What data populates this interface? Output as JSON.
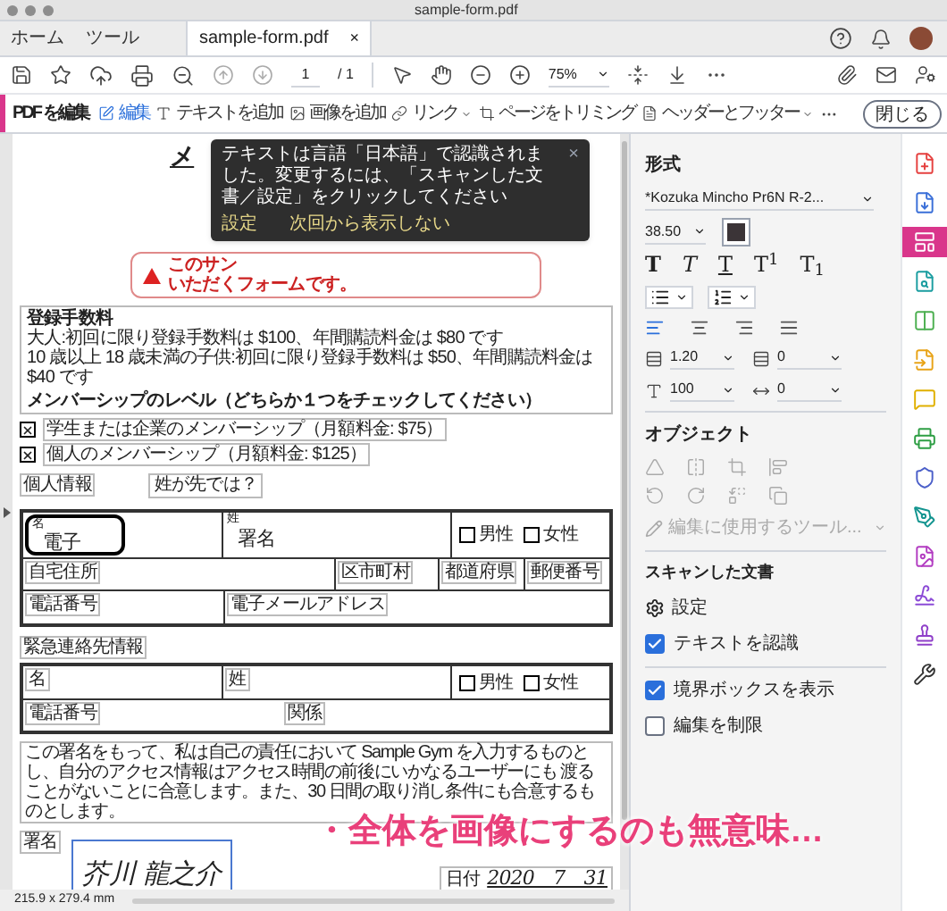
{
  "window": {
    "title": "sample-form.pdf"
  },
  "tabs": [
    {
      "label": "ホーム",
      "selected": false
    },
    {
      "label": "ツール",
      "selected": false
    },
    {
      "label": "sample-form.pdf",
      "selected": true,
      "close": "×"
    }
  ],
  "toolbar": {
    "page": "1",
    "page_total": "/ 1",
    "zoom": "75%"
  },
  "edit_bar": {
    "title": "PDF を編集",
    "tools": [
      {
        "label": "編集",
        "selected": true,
        "dropdown": false
      },
      {
        "label": "テキストを追加",
        "selected": false,
        "dropdown": false
      },
      {
        "label": "画像を追加",
        "selected": false,
        "dropdown": false
      },
      {
        "label": "リンク",
        "selected": false,
        "dropdown": true
      },
      {
        "label": "ページをトリミング",
        "selected": false,
        "dropdown": false
      },
      {
        "label": "ヘッダーとフッター",
        "selected": false,
        "dropdown": true
      }
    ],
    "close": "閉じる"
  },
  "document": {
    "heading": "メ",
    "warning": [
      "このサン",
      "いただくフォームです。"
    ],
    "toast": {
      "message": "テキストは言語「日本語」で認識されました。変更するには、「スキャンした文書／設定」をクリックしてください",
      "actions": [
        "設定",
        "次回から表示しない"
      ],
      "close": "×"
    },
    "fees": {
      "title": "登録手数料",
      "lines": [
        "大人:初回に限り登録手数料は $100、年間購読料金は $80 です",
        "10 歳以上 18 歳未満の子供:初回に限り登録手数料は $50、年間購読料金は $40 です"
      ],
      "level_title": "メンバーシップのレベル（どちらか１つをチェックしてください）"
    },
    "memberships": [
      {
        "label": "学生または企業のメンバーシップ（月額料金: $75）",
        "checked": true
      },
      {
        "label": "個人のメンバーシップ（月額料金: $125）",
        "checked": true
      }
    ],
    "comment": "姓が先では？",
    "personal": {
      "title": "個人情報",
      "first_name_label": "名",
      "first_name": "電子",
      "last_name_label": "姓",
      "last_name": "署名",
      "genders": [
        {
          "label": "男性",
          "checked": false
        },
        {
          "label": "女性",
          "checked": false
        }
      ],
      "address": "自宅住所",
      "city": "区市町村",
      "prefecture": "都道府県",
      "zip": "郵便番号",
      "phone": "電話番号",
      "email": "電子メールアドレス"
    },
    "emergency": {
      "title": "緊急連絡先情報",
      "first_name_label": "名",
      "last_name_label": "姓",
      "genders": [
        {
          "label": "男性",
          "checked": false
        },
        {
          "label": "女性",
          "checked": false
        }
      ],
      "phone": "電話番号",
      "relation": "関係"
    },
    "agreement": "この署名をもって、私は自己の責任において Sample Gym を入力するものとし、自分のアクセス情報はアクセス時間の前後にいかなるユーザーにも 渡ることがないことに合意します。また、30 日間の取り消し条件にも合意するものとします。",
    "signature": {
      "label": "署名",
      "value": "芥川 龍之介",
      "date_label": "日付",
      "date": "2020　7　31"
    }
  },
  "status_bar": "215.9 x 279.4 mm",
  "panel": {
    "format_title": "形式",
    "font": "*Kozuka Mincho Pr6N R-2...",
    "size": "38.50",
    "color": "#3b3437",
    "styles": [
      {
        "glyph": "T",
        "kind": "bold"
      },
      {
        "glyph": "T",
        "kind": "italic"
      },
      {
        "glyph": "T",
        "kind": "underline"
      },
      {
        "glyph": "T$^{1}$",
        "kind": "sup"
      },
      {
        "glyph": "T$_{1}$",
        "kind": "sub"
      }
    ],
    "alignments": [
      {
        "kind": "left",
        "selected": true
      },
      {
        "kind": "center",
        "selected": false
      },
      {
        "kind": "right",
        "selected": false
      },
      {
        "kind": "justify",
        "selected": false
      }
    ],
    "line_spacing": "1.20",
    "paragraph_spacing": "0",
    "scale": "100",
    "kerning": "0",
    "object_title": "オブジェクト",
    "edit_tool": "編集に使用するツール...",
    "scan_title": "スキャンした文書",
    "scan_settings": "設定",
    "scan_options": [
      {
        "label": "テキストを認識",
        "checked": true
      }
    ],
    "view_options": [
      {
        "label": "境界ボックスを表示",
        "checked": true
      },
      {
        "label": "編集を制限",
        "checked": false
      }
    ]
  },
  "tool_strip": [
    {
      "color": "#e5403f",
      "selected": false
    },
    {
      "color": "#3a6fd8",
      "selected": false
    },
    {
      "color": "#d9368b",
      "selected": true
    },
    {
      "color": "#1a9da0",
      "selected": false
    },
    {
      "color": "#4caf50",
      "selected": false
    },
    {
      "color": "#e8a317",
      "selected": false
    },
    {
      "color": "#e0b000",
      "selected": false
    },
    {
      "color": "#2e9e44",
      "selected": false
    },
    {
      "color": "#4b5fc9",
      "selected": false
    },
    {
      "color": "#13948f",
      "selected": false
    },
    {
      "color": "#b23cc1",
      "selected": false
    },
    {
      "color": "#8c4bd6",
      "selected": false
    },
    {
      "color": "#8f3fc9",
      "selected": false
    },
    {
      "color": "#333333",
      "selected": false
    }
  ],
  "overlay_caption": "・全体を画像にするのも無意味…"
}
